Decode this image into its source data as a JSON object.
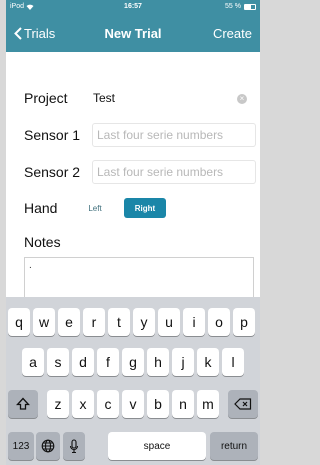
{
  "status_bar": {
    "carrier": "iPod",
    "time": "16:57",
    "battery": "55 %",
    "battery_level": 0.55
  },
  "nav": {
    "back_label": "Trials",
    "title": "New Trial",
    "action_label": "Create"
  },
  "form": {
    "project": {
      "label": "Project",
      "value": "Test"
    },
    "sensor1": {
      "label": "Sensor 1",
      "placeholder": "Last four serie numbers"
    },
    "sensor2": {
      "label": "Sensor 2",
      "placeholder": "Last four serie numbers"
    },
    "hand": {
      "label": "Hand",
      "options": [
        "Left",
        "Right"
      ],
      "selected": "Right"
    },
    "notes": {
      "label": "Notes",
      "value": "."
    }
  },
  "keyboard": {
    "row1": [
      "q",
      "w",
      "e",
      "r",
      "t",
      "y",
      "u",
      "i",
      "o",
      "p"
    ],
    "row2": [
      "a",
      "s",
      "d",
      "f",
      "g",
      "h",
      "j",
      "k",
      "l"
    ],
    "row3": [
      "z",
      "x",
      "c",
      "v",
      "b",
      "n",
      "m"
    ],
    "numbers_label": "123",
    "space_label": "space",
    "return_label": "return"
  },
  "colors": {
    "accent": "#3f8fa3",
    "segment_selected": "#1a86a8"
  }
}
